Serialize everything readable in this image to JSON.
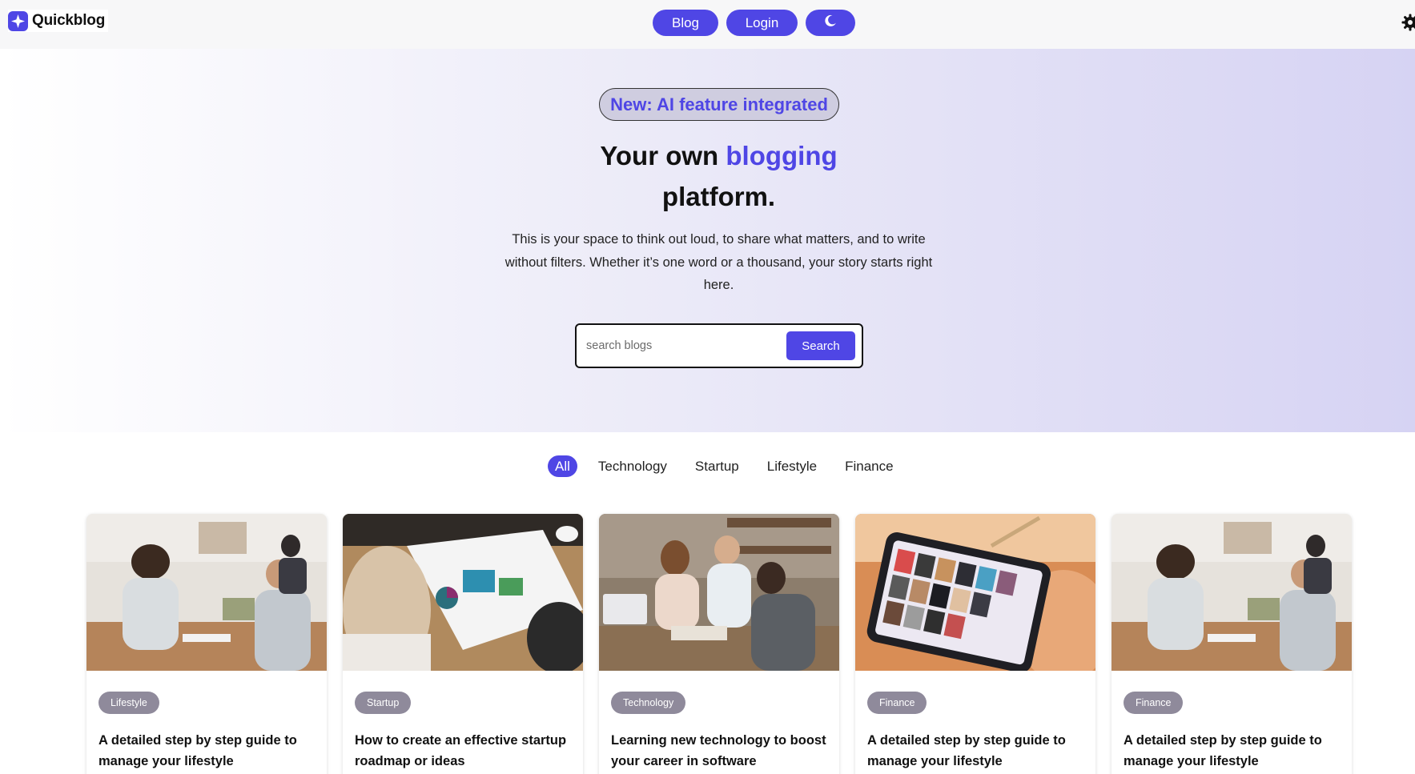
{
  "header": {
    "logo_text": "Quickblog",
    "nav": {
      "blog_label": "Blog",
      "login_label": "Login",
      "theme_icon": "moon-icon"
    },
    "settings_icon": "gear-icon"
  },
  "hero": {
    "badge": "New: AI feature integrated",
    "title_prefix": "Your own ",
    "title_accent": "blogging",
    "title_suffix": "platform.",
    "description": "This is your space to think out loud, to share what matters, and to write without filters. Whether it’s one word or a thousand, your story starts right here.",
    "search": {
      "placeholder": "search blogs",
      "value": "",
      "button_label": "Search"
    }
  },
  "filters": [
    {
      "label": "All",
      "active": true
    },
    {
      "label": "Technology",
      "active": false
    },
    {
      "label": "Startup",
      "active": false
    },
    {
      "label": "Lifestyle",
      "active": false
    },
    {
      "label": "Finance",
      "active": false
    }
  ],
  "cards": [
    {
      "tag": "Lifestyle",
      "title": "A detailed step by step guide to manage your lifestyle",
      "image": "office-meeting-photo"
    },
    {
      "tag": "Startup",
      "title": "How to create an effective startup roadmap or ideas",
      "image": "charts-on-table-photo"
    },
    {
      "tag": "Technology",
      "title": "Learning new technology to boost your career in software",
      "image": "students-studying-photo"
    },
    {
      "tag": "Finance",
      "title": "A detailed step by step guide to manage your lifestyle",
      "image": "tablet-gallery-photo"
    },
    {
      "tag": "Finance",
      "title": "A detailed step by step guide to manage your lifestyle",
      "image": "office-meeting-photo"
    }
  ],
  "colors": {
    "accent": "#4f46e5",
    "tag_bg": "#8f8a9b",
    "header_bg": "#f7f7f8"
  }
}
